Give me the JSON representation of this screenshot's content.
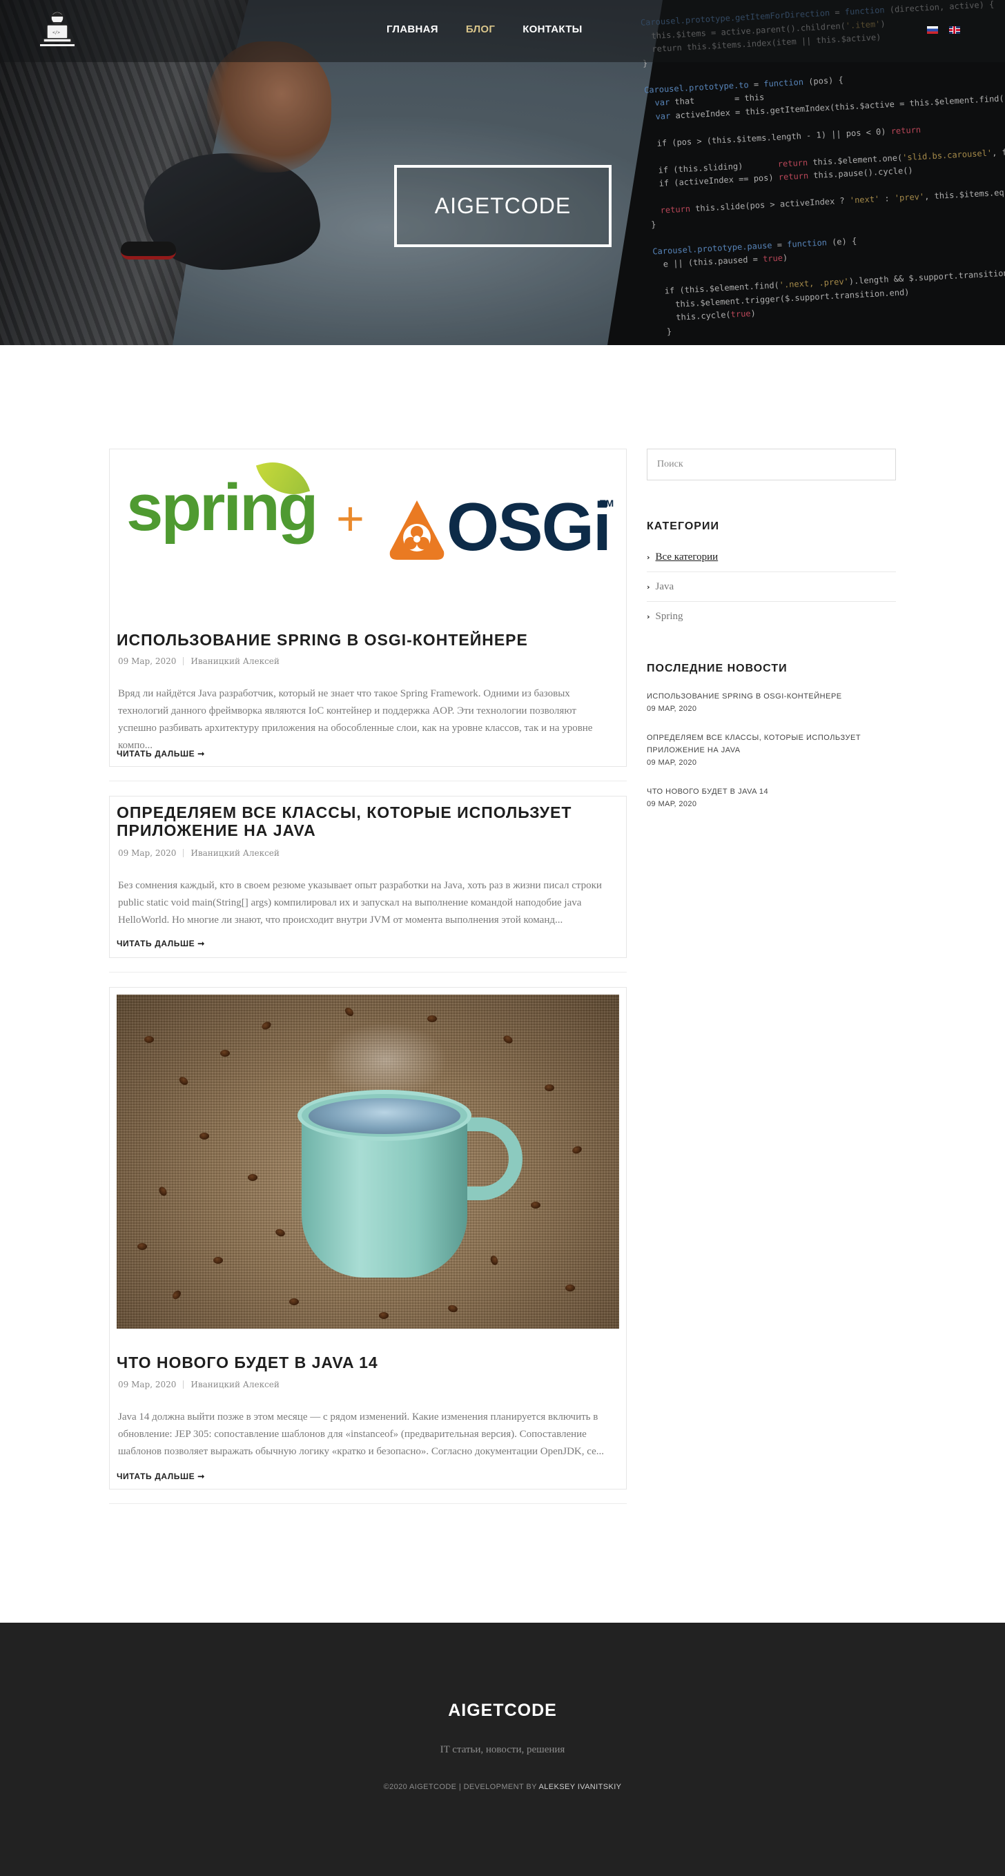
{
  "header": {
    "nav": [
      {
        "label": "ГЛАВНАЯ",
        "active": false
      },
      {
        "label": "БЛОГ",
        "active": true
      },
      {
        "label": "КОНТАКТЫ",
        "active": false
      }
    ],
    "hero_title": "AIGETCODE",
    "languages": [
      "ru-flag-icon",
      "en-flag-icon"
    ]
  },
  "posts": [
    {
      "title": "ИСПОЛЬЗОВАНИЕ SPRING В OSGI-КОНТЕЙНЕРЕ",
      "image": {
        "spring_word": "spring",
        "plus": "+",
        "osgi_word": "OSGi",
        "tm": "TM"
      },
      "date": "09 Мар, 2020",
      "author": "Иваницкий Алексей",
      "excerpt": "Вряд ли найдётся Java разработчик, который не знает что такое Spring Framework. Одними из базовых технологий данного фреймворка являются IoC контейнер и поддержка AOP. Эти технологии позволяют успешно разбивать архитектуру приложения на обособленные слои, как на уровне классов, так и на уровне компо...",
      "read_more": "ЧИТАТЬ ДАЛЬШЕ ➞"
    },
    {
      "title": "ОПРЕДЕЛЯЕМ ВСЕ КЛАССЫ, КОТОРЫЕ ИСПОЛЬЗУЕТ ПРИЛОЖЕНИЕ НА JAVA",
      "date": "09 Мар, 2020",
      "author": "Иваницкий Алексей",
      "excerpt": "Без сомнения каждый, кто в своем резюме указывает опыт разработки на Java, хоть раз в жизни писал строки public static void main(String[] args) компилировал их и запускал на выполнение командой наподобие java HelloWorld. Но многие ли знают, что происходит внутри JVM от момента выполнения этой команд...",
      "read_more": "ЧИТАТЬ ДАЛЬШЕ ➞"
    },
    {
      "title": "ЧТО НОВОГО БУДЕТ В JAVA 14",
      "date": "09 Мар, 2020",
      "author": "Иваницкий Алексей",
      "excerpt": "Java 14 должна выйти позже в этом месяце — с рядом изменений. Какие изменения планируется включить в обновление: JEP 305: сопоставление шаблонов для «instanceof» (предварительная версия). Сопоставление шаблонов позволяет выражать обычную логику «кратко и безопасно». Согласно документации OpenJDK, се...",
      "read_more": "ЧИТАТЬ ДАЛЬШЕ ➞"
    }
  ],
  "sidebar": {
    "search_placeholder": "Поиск",
    "categories_title": "КАТЕГОРИИ",
    "categories": [
      {
        "label": "Все категории",
        "active": true
      },
      {
        "label": "Java",
        "active": false
      },
      {
        "label": "Spring",
        "active": false
      }
    ],
    "news_title": "ПОСЛЕДНИЕ НОВОСТИ",
    "news": [
      {
        "title": "ИСПОЛЬЗОВАНИЕ SPRING В OSGI-КОНТЕЙНЕРЕ",
        "date": "09 МАР, 2020"
      },
      {
        "title": "ОПРЕДЕЛЯЕМ ВСЕ КЛАССЫ, КОТОРЫЕ ИСПОЛЬЗУЕТ ПРИЛОЖЕНИЕ НА JAVA",
        "date": "09 МАР, 2020"
      },
      {
        "title": "ЧТО НОВОГО БУДЕТ В JAVA 14",
        "date": "09 МАР, 2020"
      }
    ]
  },
  "footer": {
    "title": "AIGETCODE",
    "tagline": "IT статьи, новости, решения",
    "copyright": "©2020 AIGETCODE | DEVELOPMENT BY",
    "developer": "ALEKSEY IVANITSKIY"
  },
  "colors": {
    "nav_active": "#d8c48a",
    "footer_bg": "#222222",
    "spring_green": "#4f9a31",
    "osgi_orange": "#ea8a2c",
    "osgi_navy": "#0d2b48"
  }
}
